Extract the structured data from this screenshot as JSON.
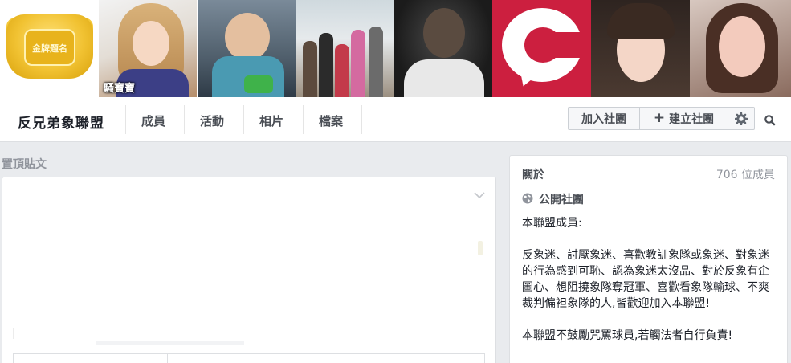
{
  "cover": {
    "tiles": [
      {
        "name": "group-badge-photo",
        "caption": "",
        "badge_text": "金牌題名"
      },
      {
        "name": "member-photo-1",
        "caption": "騷寶寶"
      },
      {
        "name": "member-photo-2",
        "caption": ""
      },
      {
        "name": "member-photo-3",
        "caption": ""
      },
      {
        "name": "member-photo-4",
        "caption": ""
      },
      {
        "name": "member-photo-5",
        "caption": ""
      },
      {
        "name": "member-photo-6",
        "caption": ""
      },
      {
        "name": "member-photo-7",
        "caption": ""
      }
    ],
    "logo_color": "#cc1f3f"
  },
  "nav": {
    "group_name": "反兄弟象聯盟",
    "tabs": [
      "成員",
      "活動",
      "相片",
      "檔案"
    ],
    "join_label": "加入社團",
    "create_label": "建立社團",
    "icons": {
      "create": "plus-icon",
      "settings": "gear-icon",
      "search": "search-icon"
    }
  },
  "pinned": {
    "label": "置頂貼文",
    "icons": {
      "menu": "chevron-down-icon"
    }
  },
  "about": {
    "title": "關於",
    "members": "706 位成員",
    "privacy": "公開社團",
    "privacy_icon": "globe-icon",
    "paragraphs": [
      "本聯盟成員:",
      "反象迷、討厭象迷、喜歡教訓象隊或象迷、對象迷的行為感到可恥、認為象迷太沒品、對於反象有企圖心、想阻撓象隊奪冠軍、喜歡看象隊輸球、不爽裁判偏袒象隊的人,皆歡迎加入本聯盟!",
      "本聯盟不鼓勵咒罵球員,若觸法者自行負責!"
    ]
  }
}
